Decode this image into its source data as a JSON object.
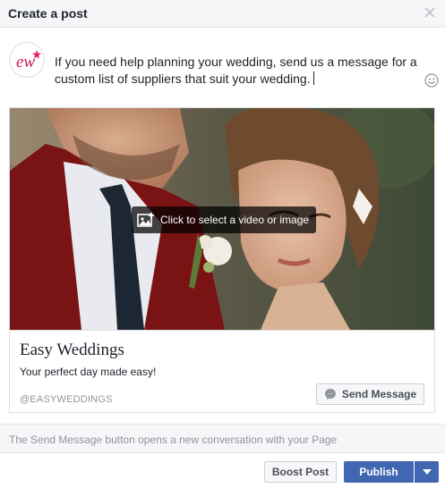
{
  "dialog": {
    "title": "Create a post"
  },
  "composer": {
    "text": "If you need help planning your wedding, send us a message for a custom list of suppliers that suit your wedding."
  },
  "avatar": {
    "logo_text": "ew"
  },
  "media": {
    "select_label": "Click to select a video or image"
  },
  "card": {
    "title": "Easy Weddings",
    "description": "Your perfect day made easy!",
    "domain": "@EASYWEDDINGS",
    "cta_label": "Send Message"
  },
  "note": {
    "text": "The Send Message button opens a new conversation with your Page"
  },
  "footer": {
    "boost_label": "Boost Post",
    "publish_label": "Publish"
  },
  "colors": {
    "brand_blue": "#4267b2",
    "logo_pink": "#c2185b",
    "muted_text": "#90949c"
  },
  "icons": {
    "close": "close-icon",
    "emoji": "emoji-icon",
    "photo": "photo-icon",
    "messenger": "messenger-icon",
    "dropdown": "chevron-down-icon"
  }
}
